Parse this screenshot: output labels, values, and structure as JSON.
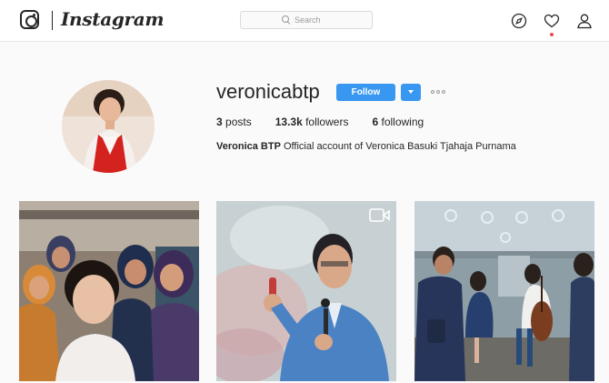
{
  "header": {
    "brand": "Instagram",
    "search_placeholder": "Search",
    "icons": [
      "instagram-logo-icon",
      "compass-icon",
      "heart-icon",
      "person-icon"
    ],
    "notification_dot_color": "#ed4956"
  },
  "profile": {
    "username": "veronicabtp",
    "follow_label": "Follow",
    "stats": {
      "posts": {
        "count": "3",
        "label": "posts"
      },
      "followers": {
        "count": "13.3k",
        "label": "followers"
      },
      "following": {
        "count": "6",
        "label": "following"
      }
    },
    "full_name": "Veronica BTP",
    "bio": "Official account of Veronica Basuki Tjahaja Purnama"
  },
  "posts": [
    {
      "type": "photo"
    },
    {
      "type": "video",
      "icon": "video-camera-icon"
    },
    {
      "type": "photo"
    }
  ],
  "colors": {
    "accent": "#3897f0",
    "text": "#262626",
    "background": "#fafafa"
  }
}
